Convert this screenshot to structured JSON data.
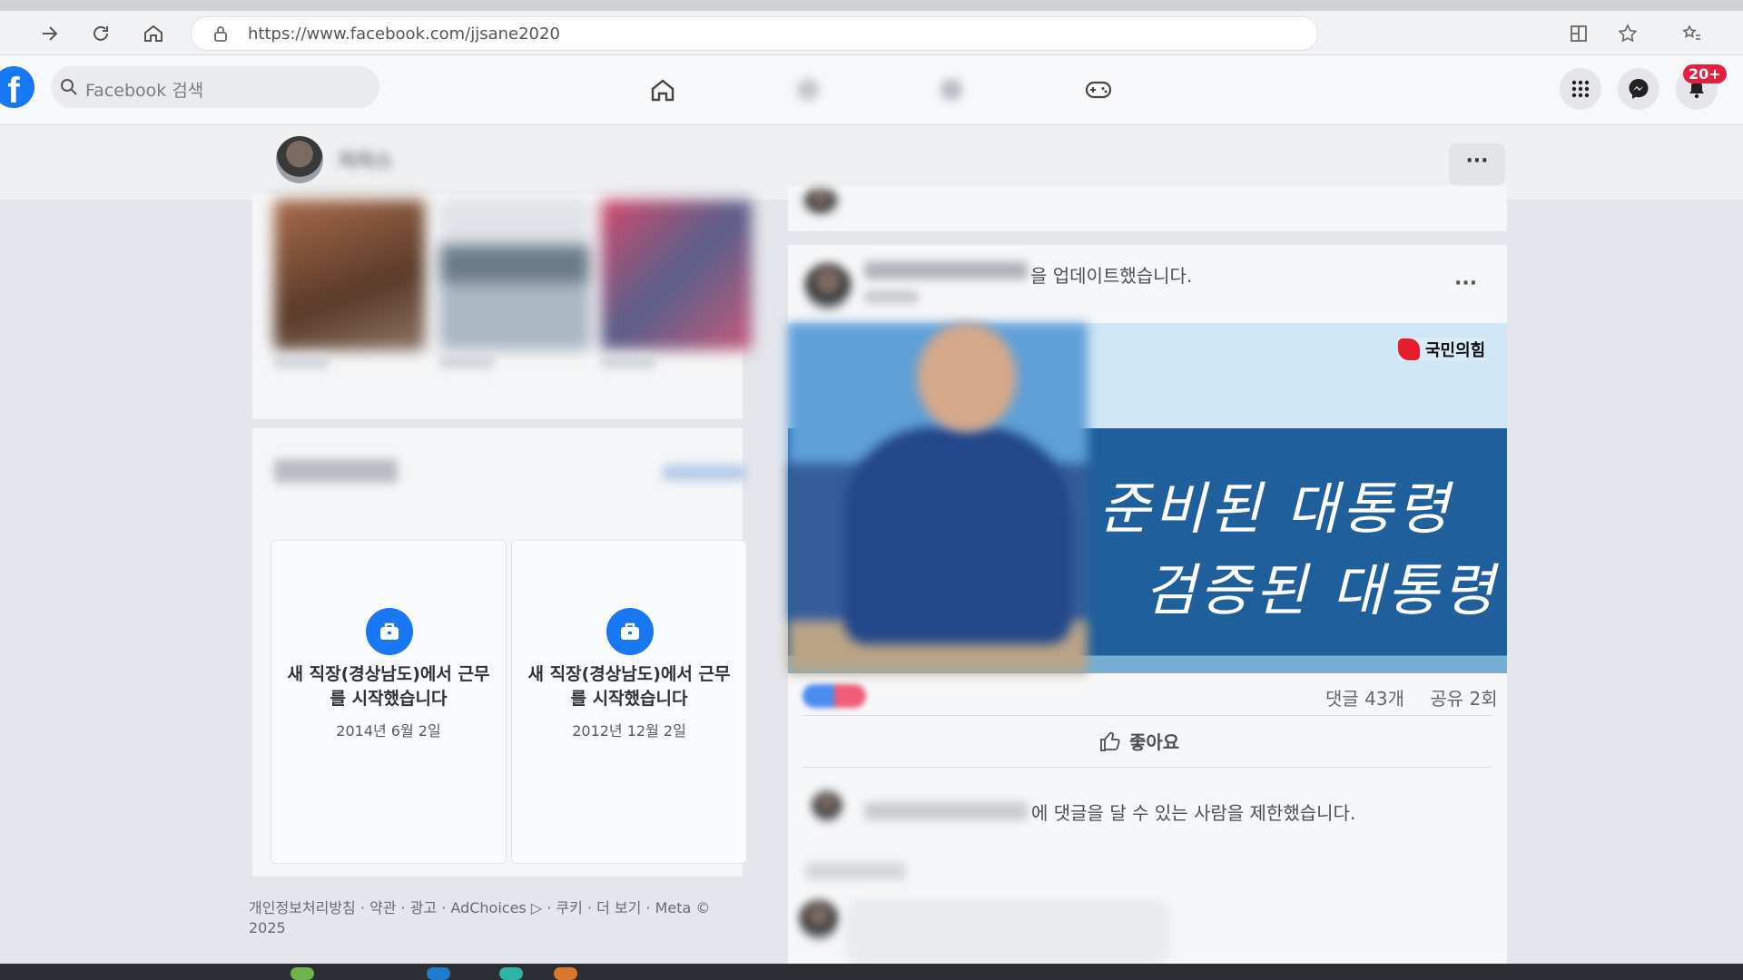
{
  "browser": {
    "url": "https://www.facebook.com/jjsane2020"
  },
  "facebook": {
    "logo_letter": "f",
    "search_placeholder": "Facebook 검색",
    "notification_count": "20+"
  },
  "profile": {
    "name": "저자스"
  },
  "life_events": [
    {
      "title": "새 직장(경상남도)에서 근무를 시작했습니다",
      "date": "2014년 6월 2일"
    },
    {
      "title": "새 직장(경상남도)에서 근무를 시작했습니다",
      "date": "2012년 12월 2일"
    }
  ],
  "footer": {
    "links": "개인정보처리방침 · 약관 · 광고 · AdChoices ▷ · 쿠키 · 더 보기 · Meta © 2025"
  },
  "post": {
    "update_text": "을 업데이트했습니다.",
    "more": "···",
    "image_logo": "국민의힘",
    "banner_line1": "준비된 대통령",
    "banner_line2": "검증된 대통령",
    "comments": "댓글 43개",
    "shares": "공유 2회",
    "like_label": "좋아요",
    "comment_limit_text": "에 댓글을 달 수 있는 사람을 제한했습니다."
  },
  "colors": {
    "fb_blue": "#1877f2",
    "badge_red": "#e41e3f",
    "logo_red": "#e61e2b"
  }
}
